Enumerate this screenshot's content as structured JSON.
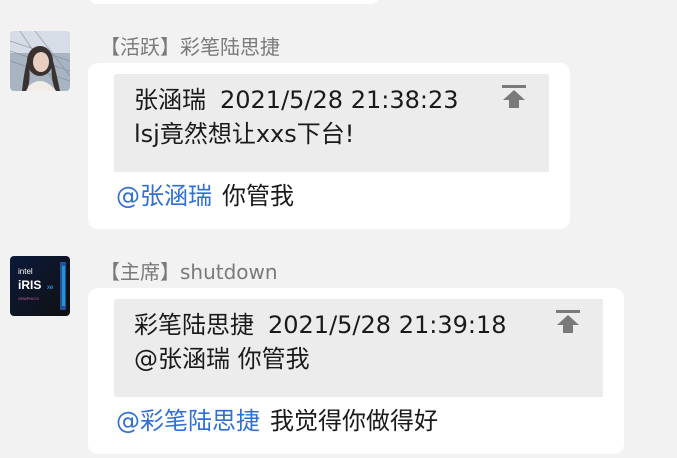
{
  "messages": [
    {
      "sender": "【活跃】彩笔陆思捷",
      "quote": {
        "author": "张涵瑞",
        "time": "2021/5/28 21:38:23",
        "text": "lsj竟然想让xxs下台!"
      },
      "mention": "@张涵瑞",
      "text": "你管我"
    },
    {
      "sender": "【主席】shutdown",
      "quote": {
        "author": "彩笔陆思捷",
        "time": "2021/5/28 21:39:18",
        "text": "@张涵瑞 你管我"
      },
      "mention": "@彩笔陆思捷",
      "text": "我觉得你做得好"
    }
  ],
  "avatar2_logo": {
    "brand": "intel",
    "product": "iRIS",
    "suffix": "xe",
    "tag": "GRAPHICS"
  },
  "colors": {
    "background": "#f2f2f2",
    "bubble": "#ffffff",
    "quote_bg": "#ececec",
    "mention": "#2f6fd6",
    "sender": "#7a7a7a"
  },
  "icons": {
    "jump": "jump-to-top-icon"
  }
}
